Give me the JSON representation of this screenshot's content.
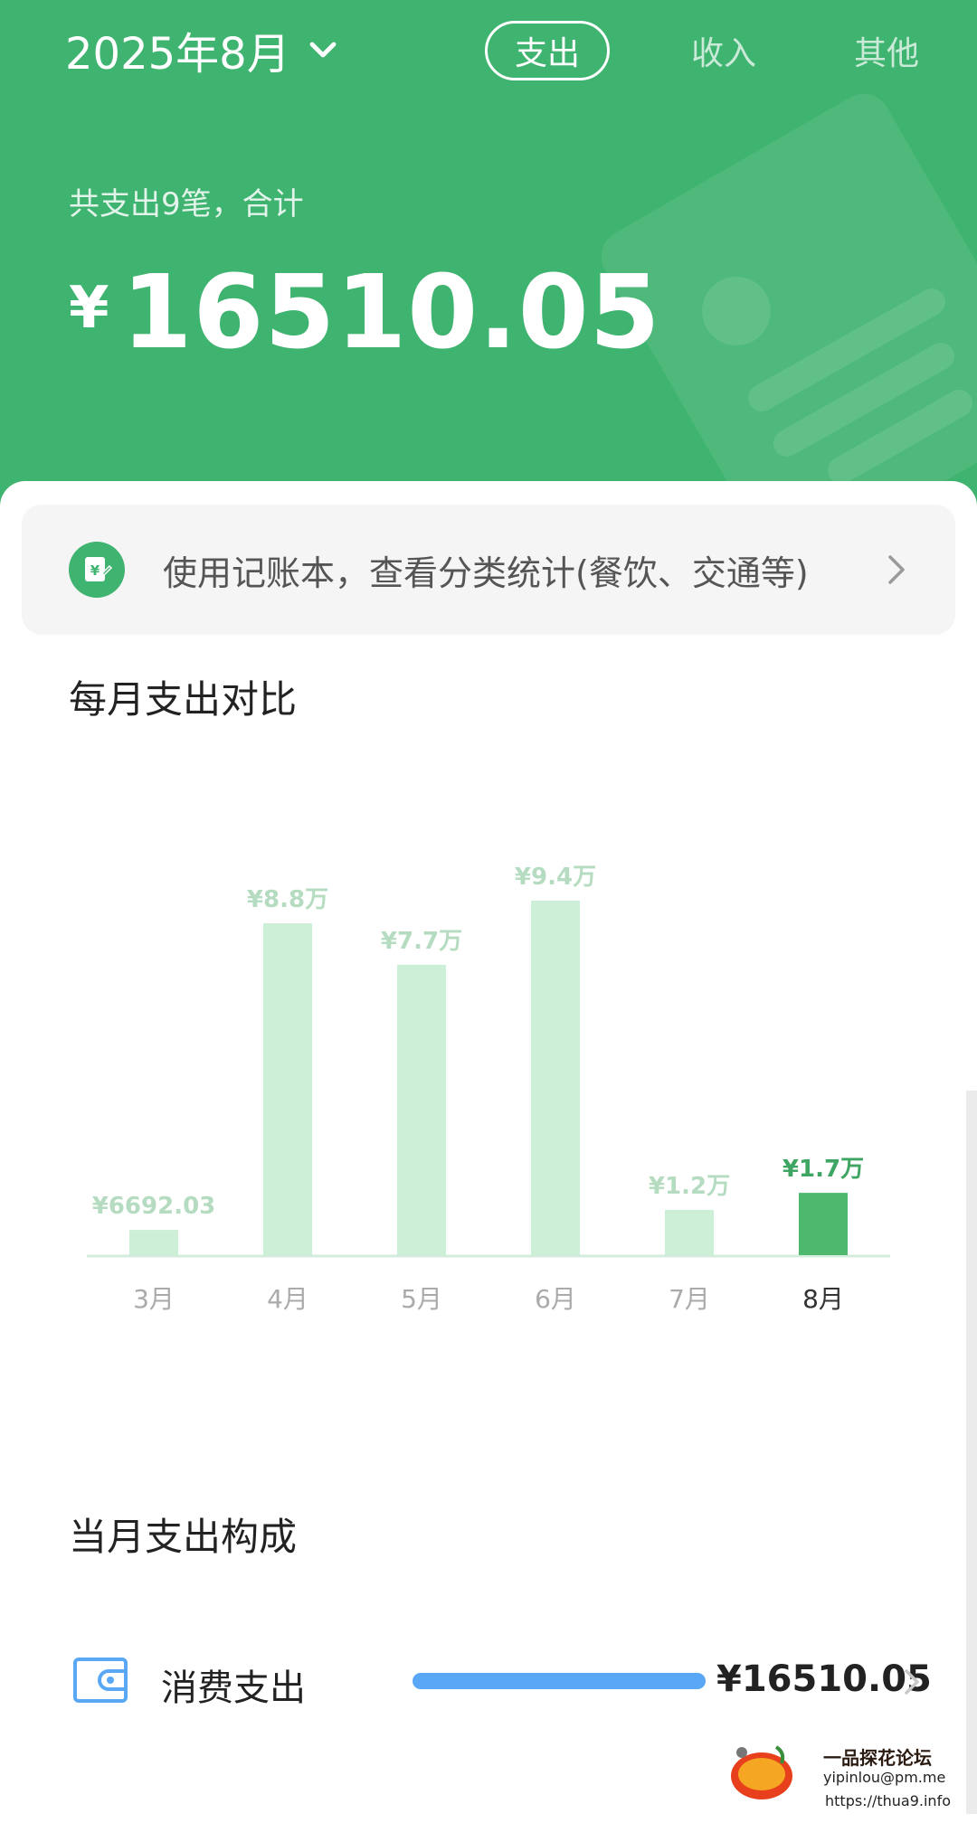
{
  "header": {
    "month_selector": "2025年8月",
    "tabs": [
      {
        "label": "支出",
        "active": true
      },
      {
        "label": "收入",
        "active": false
      },
      {
        "label": "其他",
        "active": false
      }
    ],
    "summary": "共支出9笔，合计",
    "currency_symbol": "¥",
    "total_amount": "16510.05",
    "background_color": "#3fb370"
  },
  "notice": {
    "icon": "ledger-yuan-icon",
    "text": "使用记账本，查看分类统计(餐饮、交通等)"
  },
  "monthly_chart": {
    "title": "每月支出对比"
  },
  "chart_data": {
    "type": "bar",
    "categories": [
      "3月",
      "4月",
      "5月",
      "6月",
      "7月",
      "8月"
    ],
    "values": [
      6692.03,
      88000,
      77000,
      94000,
      12000,
      16510.05
    ],
    "data_labels": [
      "¥6692.03",
      "¥8.8万",
      "¥7.7万",
      "¥9.4万",
      "¥1.2万",
      "¥1.7万"
    ],
    "highlight_index": 5,
    "colors": {
      "normal": "#cdeed7",
      "highlight": "#4db86e",
      "label_normal": "#b5dcc0",
      "label_highlight": "#3fa563"
    },
    "xlabel": "",
    "ylabel": "",
    "grid": false
  },
  "composition": {
    "title": "当月支出构成",
    "items": [
      {
        "icon": "wallet-icon",
        "name": "消费支出",
        "share": 1.0,
        "amount": "¥16510.05",
        "bar_color": "#5aa8f5"
      }
    ]
  },
  "watermark": {
    "logo": "yipinlou-logo",
    "title": "一品探花论坛",
    "email": "yipinlou@pm.me",
    "url": "https://thua9.info"
  }
}
